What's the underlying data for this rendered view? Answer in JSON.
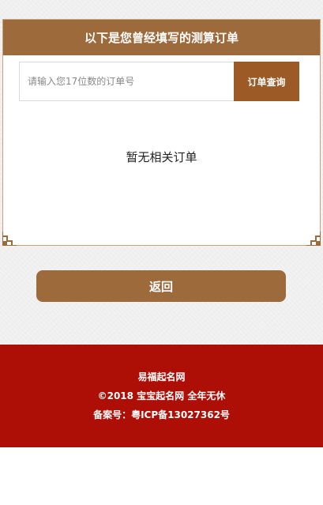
{
  "card": {
    "header_title": "以下是您曾经填写的测算订单",
    "search": {
      "placeholder": "请输入您17位数的订单号",
      "value": "",
      "button_label": "订单查询"
    },
    "empty_message": "暂无相关订单"
  },
  "back_button_label": "返回",
  "footer": {
    "site_name": "易福起名网",
    "copyright": "©2018 宝宝起名网 全年无休",
    "icp": "备案号：粤ICP备13027362号"
  },
  "colors": {
    "header_brown": "#9d6a3c",
    "button_brown": "#9b5a26",
    "footer_red": "#ad0e05",
    "card_border": "#c8a37c"
  },
  "icons": {
    "corner_left": "decorative-corner-icon",
    "corner_right": "decorative-corner-icon"
  }
}
